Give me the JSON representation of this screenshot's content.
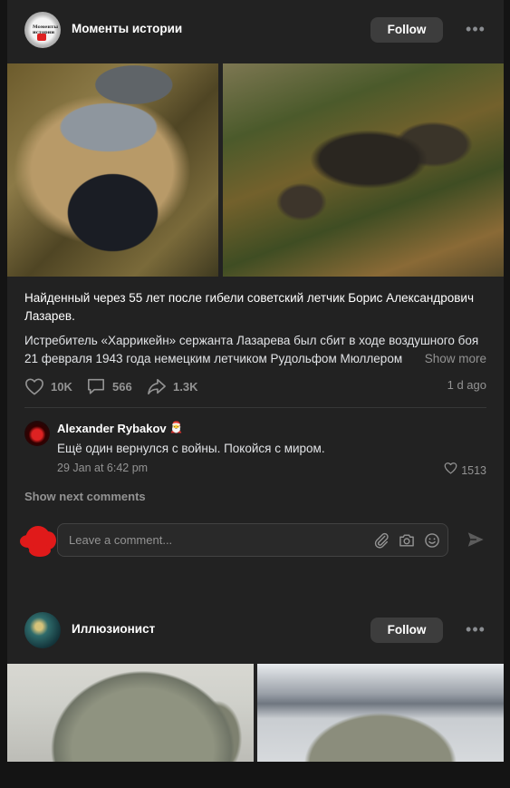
{
  "posts": [
    {
      "channel": {
        "name": "Моменты истории",
        "avatar_text": "Моменты истории"
      },
      "follow_label": "Follow",
      "more_label": "•••",
      "title": "Найденный через 55 лет после гибели советский летчик Борис Александрович Лазарев.",
      "body": "Истребитель «Харрикейн» сержанта Лазарева был сбит в ходе воздушного боя 21 февраля 1943 года немецким летчиком Рудольфом Мюллером",
      "show_more": "Show more",
      "stats": {
        "likes": "10K",
        "comments": "566",
        "shares": "1.3K"
      },
      "time": "1 d ago",
      "comment": {
        "author": "Alexander Rybakov",
        "author_emoji": "🎅",
        "text": "Ещё один вернулся с войны. Покойся с миром.",
        "date": "29 Jan at 6:42 pm",
        "likes": "1513"
      },
      "show_next_comments": "Show next comments",
      "compose": {
        "placeholder": "Leave a comment..."
      }
    },
    {
      "channel": {
        "name": "Иллюзионист"
      },
      "follow_label": "Follow",
      "more_label": "•••"
    }
  ],
  "colors": {
    "background": "#141414",
    "card": "#222222",
    "text": "#e1e3e6",
    "muted": "#939393",
    "button": "#3d3d3d"
  }
}
